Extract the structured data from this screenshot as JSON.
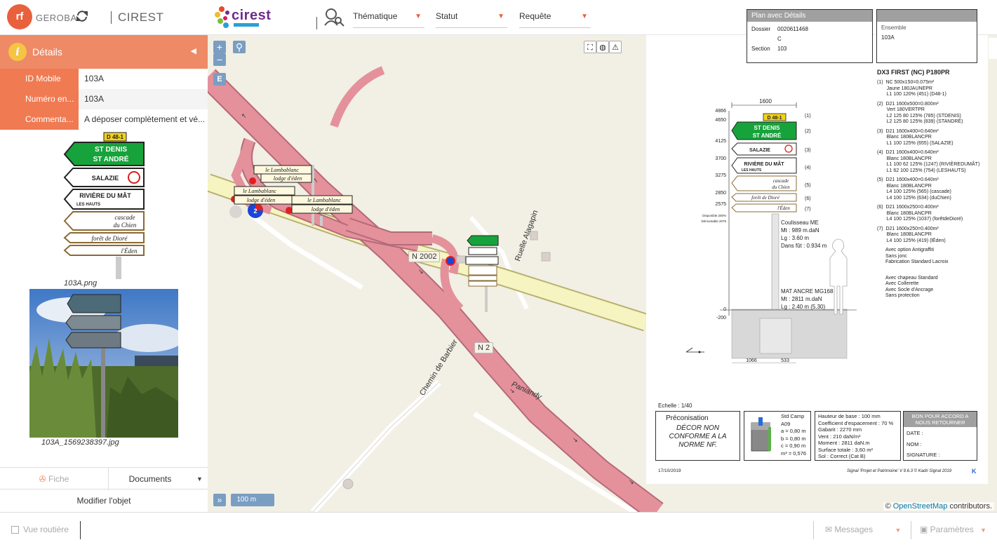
{
  "header": {
    "logo_text": "rf",
    "brand": "GEROBA",
    "app_name": "CIREST",
    "cirest_logo": "cirest",
    "dropdowns": [
      "Thématique",
      "Statut",
      "Requête"
    ],
    "accent": "#e9603d"
  },
  "panel": {
    "title": "Détails",
    "rows": [
      {
        "label": "ID Mobile",
        "value": "103A"
      },
      {
        "label": "Numéro en...",
        "value": "103A"
      },
      {
        "label": "Commenta...",
        "value": "A déposer complètement et vé..."
      }
    ],
    "image1_caption": "103A.png",
    "image2_caption": "103A_1569238397.jpg",
    "tabs": [
      "Fiche",
      "Documents"
    ],
    "modify": "Modifier l'objet",
    "sign": {
      "route": "D 48-1",
      "line1": "ST DENIS",
      "line2": "ST ANDRÉ",
      "salazie": "SALAZIE",
      "riviere1": "RIVIÈRE DU MÂT",
      "riviere2": "LES HAUTS",
      "cascade1": "cascade",
      "cascade2": "du Chien",
      "foret": "forêt de Dioré",
      "eden": "l'Éden"
    }
  },
  "map": {
    "zoom_in": "+",
    "zoom_out": "−",
    "layer_btn": "E",
    "road_n2002": "N 2002",
    "road_n2": "N 2",
    "street_alagapin": "Ruelle Alagapin",
    "street_barbier": "Chemin de Barbier",
    "place_paniandy": "Paniandy",
    "sign_lambablanc": "le Lambablanc",
    "sign_lodge": "lodge d'éden",
    "marker_number": "2",
    "scale": "100 m",
    "expand": "»",
    "attribution_prefix": "©",
    "attribution_link": "OpenStreetMap",
    "attribution_suffix": "contributors."
  },
  "plan": {
    "box1_title": "Plan avec Détails",
    "box1_labels": [
      "Dossier",
      "Section"
    ],
    "box1_values": [
      "0020611468",
      "C",
      "103"
    ],
    "box2_label": "Ensemble",
    "box2_value": "103A",
    "model": "DX3 FIRST (NC) P180PR",
    "width_dim": "1600",
    "heights": [
      "4866",
      "4650",
      "4125",
      "3700",
      "3275",
      "2850",
      "2575",
      "0",
      "-200"
    ],
    "dispo": "Disponible 200%",
    "dispo2": "Démontable 2075",
    "coulisseau": [
      "Coulisseau ME",
      "Mt : 989 m.daN",
      "Lg : 3.60 m",
      "Dans fût : 0.934 m"
    ],
    "mat": [
      "MAT ANCRE MG168",
      "Mt : 2811 m.daN",
      "Lg : 2.40 m (5.30)"
    ],
    "base_dims": [
      "1066",
      "533"
    ],
    "nums": [
      "(1)",
      "(2)",
      "(3)",
      "(4)",
      "(5)",
      "(6)",
      "(7)"
    ],
    "specs": [
      "(1)  NC 500x150=0.075m²\n       Jaune 180JAUNEPR\n       L1 100 120% (451) (D48-1)",
      "(2)  D21 1600x500=0.800m²\n       Vert 180VERTPR\n       L2 125 80 125% (785) (STDENIS)\n       L2 125 80 125% (839) (STANDRÉ)",
      "(3)  D21 1600x400=0.640m²\n       Blanc 180BLANCPR\n       L1 100 125% (655) (SALAZIE)",
      "(4)  D21 1600x400=0.640m²\n       Blanc 180BLANCPR\n       L1 100 62 125% (1247) (RIVIÈREDUMÂT)\n       L1 62 100 125% (754) (LESHAUTS)",
      "(5)  D21 1600x400=0.640m²\n       Blanc 180BLANCPR\n       L4 100 125% (565) (cascade)\n       L4 100 125% (634) (duChien)",
      "(6)  D21 1600x250=0.400m²\n       Blanc 180BLANCPR\n       L4 100 125% (1037) (forêtdeDioré)",
      "(7)  D21 1600x250=0.400m²\n       Blanc 180BLANCPR\n       L4 100 125% (419) (lÉden)"
    ],
    "options": "Avec option Antigraffiti\nSans jonc\nFabrication Standard Lacroix",
    "options2": "Avec chapeau Standard\nAvec Collerette\nAvec Socle d'Ancrage\nSans protection",
    "echelle": "Echelle : 1/40",
    "preco_title": "Préconisation",
    "preco_text": "DÉCOR NON CONFORME A LA NORME NF.",
    "camp": [
      "Std Camp",
      "A09",
      "a = 0,80 m",
      "b = 0,80 m",
      "c = 0,90 m",
      "m³ = 0,576"
    ],
    "base_info": [
      "Hauteur de base : 100 mm",
      "Coefficient d'espacement : 70 %",
      "Gabarit : 2270 mm",
      "Vent : 210 daN/m²",
      "Moment : 2811 daN.m",
      "Surface totale : 3,60 m²",
      "Sol : Correct (Cat B)"
    ],
    "bon_title": "BON POUR ACCORD A NOUS RETOURNER",
    "bon_fields": [
      "DATE :",
      "NOM :",
      "SIGNATURE :"
    ],
    "date": "17/10/2019",
    "software": "Signal 'Projet et Patrimoine' V 9.6.3 © Kadri Signal 2019"
  },
  "status": {
    "vue": "Vue routière",
    "messages": "Messages",
    "params": "Paramètres"
  }
}
